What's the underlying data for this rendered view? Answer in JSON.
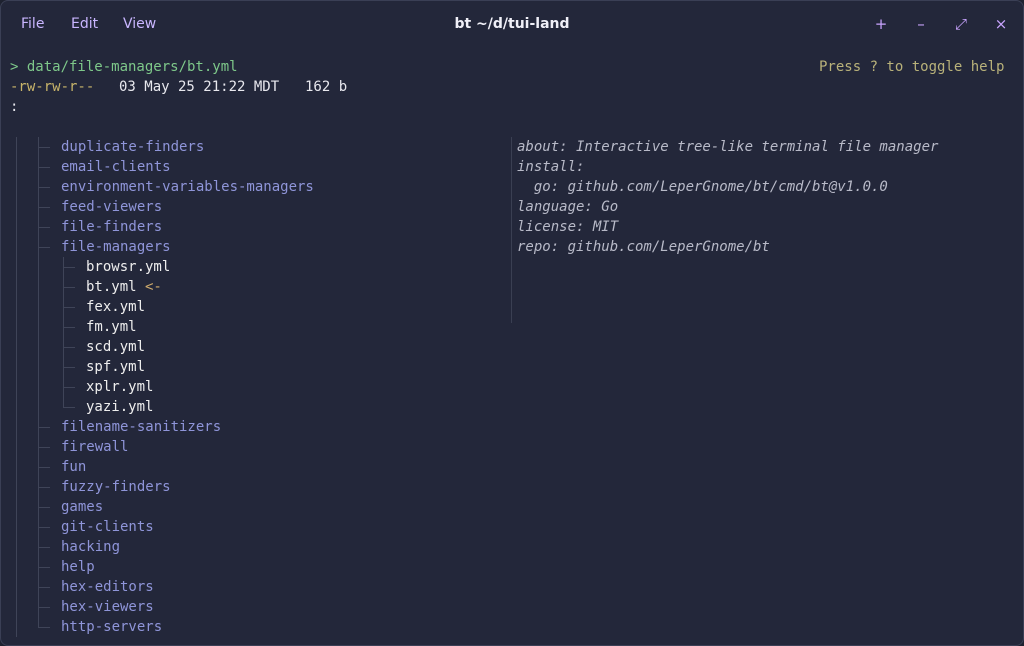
{
  "menu": {
    "file": "File",
    "edit": "Edit",
    "view": "View"
  },
  "window": {
    "title": "bt ~/d/tui-land",
    "add_icon": "+",
    "minimize_icon": "–",
    "maximize_icon": "⤢",
    "close_icon": "×"
  },
  "header": {
    "path": "> data/file-managers/bt.yml",
    "help_hint": "Press ? to toggle help",
    "permissions": "-rw-rw-r--",
    "modified": "03 May 25 21:22 MDT",
    "size": "162 b",
    "prompt": ":"
  },
  "tree": {
    "entries": [
      {
        "name": "duplicate-finders",
        "type": "dir"
      },
      {
        "name": "email-clients",
        "type": "dir"
      },
      {
        "name": "environment-variables-managers",
        "type": "dir"
      },
      {
        "name": "feed-viewers",
        "type": "dir"
      },
      {
        "name": "file-finders",
        "type": "dir"
      },
      {
        "name": "file-managers",
        "type": "dir"
      },
      {
        "name": "browsr.yml",
        "type": "file"
      },
      {
        "name": "bt.yml",
        "type": "file"
      },
      {
        "name": "fex.yml",
        "type": "file"
      },
      {
        "name": "fm.yml",
        "type": "file"
      },
      {
        "name": "scd.yml",
        "type": "file"
      },
      {
        "name": "spf.yml",
        "type": "file"
      },
      {
        "name": "xplr.yml",
        "type": "file"
      },
      {
        "name": "yazi.yml",
        "type": "file"
      },
      {
        "name": "filename-sanitizers",
        "type": "dir"
      },
      {
        "name": "firewall",
        "type": "dir"
      },
      {
        "name": "fun",
        "type": "dir"
      },
      {
        "name": "fuzzy-finders",
        "type": "dir"
      },
      {
        "name": "games",
        "type": "dir"
      },
      {
        "name": "git-clients",
        "type": "dir"
      },
      {
        "name": "hacking",
        "type": "dir"
      },
      {
        "name": "help",
        "type": "dir"
      },
      {
        "name": "hex-editors",
        "type": "dir"
      },
      {
        "name": "hex-viewers",
        "type": "dir"
      },
      {
        "name": "http-servers",
        "type": "dir"
      }
    ],
    "selected_marker": "<-"
  },
  "preview": {
    "lines": [
      "about: Interactive tree-like terminal file manager",
      "install:",
      "  go: github.com/LeperGnome/bt/cmd/bt@v1.0.0",
      "language: Go",
      "license: MIT",
      "repo: github.com/LeperGnome/bt"
    ]
  },
  "colors": {
    "background": "#23273a",
    "accent": "#c9a4ff",
    "directory": "#8f95d9",
    "path": "#7ec88a"
  }
}
